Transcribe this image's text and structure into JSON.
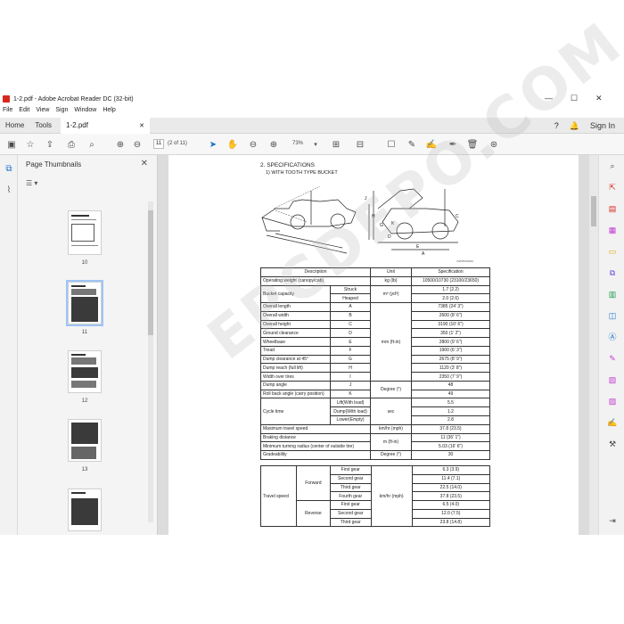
{
  "window": {
    "title": "1-2.pdf - Adobe Acrobat Reader DC (32-bit)",
    "minimize": "—",
    "maximize": "☐",
    "close": "✕"
  },
  "menu": [
    "File",
    "Edit",
    "View",
    "Sign",
    "Window",
    "Help"
  ],
  "tabs": {
    "home": "Home",
    "tools": "Tools",
    "doc": "1-2.pdf",
    "doc_close": "✕",
    "sign_in": "Sign In"
  },
  "toolbar": {
    "page_value": "11",
    "page_count": "(2 of 11)",
    "zoom": "73%"
  },
  "thumbs": {
    "header": "Page Thumbnails",
    "close": "✕",
    "options": "☰ ▾",
    "pages": [
      "10",
      "11",
      "12",
      "13"
    ]
  },
  "document": {
    "heading": "2. SPECIFICATIONS",
    "subheading": "1) WITH TOOTH TYPE BUCKET",
    "figure_code": "7WN5SS0002",
    "watermark": "EPCDEPO.COM",
    "table": {
      "headers": [
        "Description",
        "Unit",
        "Specification"
      ],
      "rows": [
        [
          "Operating weight (canopy/cab)",
          "",
          "kg (lb)",
          "10500/10730 (23100/23650)"
        ],
        [
          "Bucket capacity",
          "Struck",
          "m³ (yd³)",
          "1.7 (2.2)"
        ],
        [
          "",
          "Heaped",
          "",
          "2.0 (2.6)"
        ],
        [
          "Overall length",
          "A",
          "",
          "7385 (24' 3\")"
        ],
        [
          "Overall width",
          "B",
          "",
          "2600 (8' 6\")"
        ],
        [
          "Overall height",
          "C",
          "",
          "3190 (10' 6\")"
        ],
        [
          "Ground clearance",
          "D",
          "",
          "350 (1' 2\")"
        ],
        [
          "Wheelbase",
          "E",
          "mm (ft-in)",
          "2800 (9' 6\")"
        ],
        [
          "Tread",
          "F",
          "",
          "1900 (6' 3\")"
        ],
        [
          "Dump clearance at 45°",
          "G",
          "",
          "2675 (8' 9\")"
        ],
        [
          "Dump reach (full lift)",
          "H",
          "",
          "1120 (3' 8\")"
        ],
        [
          "Width over tires",
          "I",
          "",
          "2350 (7' 9\")"
        ],
        [
          "Dump angle",
          "J",
          "Degree (°)",
          "48"
        ],
        [
          "Roll back angle (carry position)",
          "K",
          "",
          "49"
        ],
        [
          "Cycle time",
          "Lift(With load)",
          "",
          "5.5"
        ],
        [
          "",
          "Dump(With load)",
          "sec",
          "1.2"
        ],
        [
          "",
          "Lower(Empty)",
          "",
          "2.8"
        ],
        [
          "Maximum travel speed",
          "",
          "km/hr (mph)",
          "37.8 (23.5)"
        ],
        [
          "Braking distance",
          "",
          "m (ft-in)",
          "11 (36' 1\")"
        ],
        [
          "Minimum turning radius (center of outside tire)",
          "",
          "",
          "5.03 (16' 6\")"
        ],
        [
          "Gradeability",
          "",
          "Degree (°)",
          "30"
        ],
        [
          "Travel speed",
          "Forward",
          "First gear",
          "km/hr (mph)",
          "6.3 (3.9)"
        ],
        [
          "",
          "",
          "Second gear",
          "",
          "11.4 (7.1)"
        ],
        [
          "",
          "",
          "Third gear",
          "",
          "22.5 (14.0)"
        ],
        [
          "",
          "",
          "Fourth gear",
          "",
          "37.8 (23.5)"
        ],
        [
          "",
          "Reverse",
          "First gear",
          "",
          "6.5 (4.0)"
        ],
        [
          "",
          "",
          "Second gear",
          "",
          "12.0 (7.5)"
        ],
        [
          "",
          "",
          "Third gear",
          "",
          "23.8 (14.8)"
        ]
      ]
    }
  }
}
